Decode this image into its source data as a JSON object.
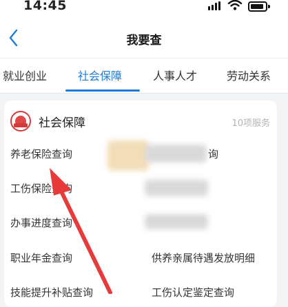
{
  "status": {
    "time": "14:45"
  },
  "nav": {
    "title": "我要查"
  },
  "tabs": [
    {
      "label": "就业创业"
    },
    {
      "label": "社会保障"
    },
    {
      "label": "人事人才"
    },
    {
      "label": "劳动关系"
    }
  ],
  "card": {
    "title": "社会保障",
    "count": "10项服务",
    "left_items": [
      {
        "label": "养老保险查询"
      },
      {
        "label": "工伤保险查询"
      },
      {
        "label": "办事进度查询"
      },
      {
        "label": "职业年金查询"
      },
      {
        "label": "技能提升补贴查询"
      }
    ],
    "right_items": [
      {
        "label": "询"
      },
      {
        "label": ""
      },
      {
        "label": ""
      },
      {
        "label": "供养亲属待遇发放明细"
      },
      {
        "label": "工伤认定鉴定查询"
      }
    ]
  },
  "colors": {
    "accent": "#1e7bd8",
    "arrow": "#e63b3b"
  }
}
